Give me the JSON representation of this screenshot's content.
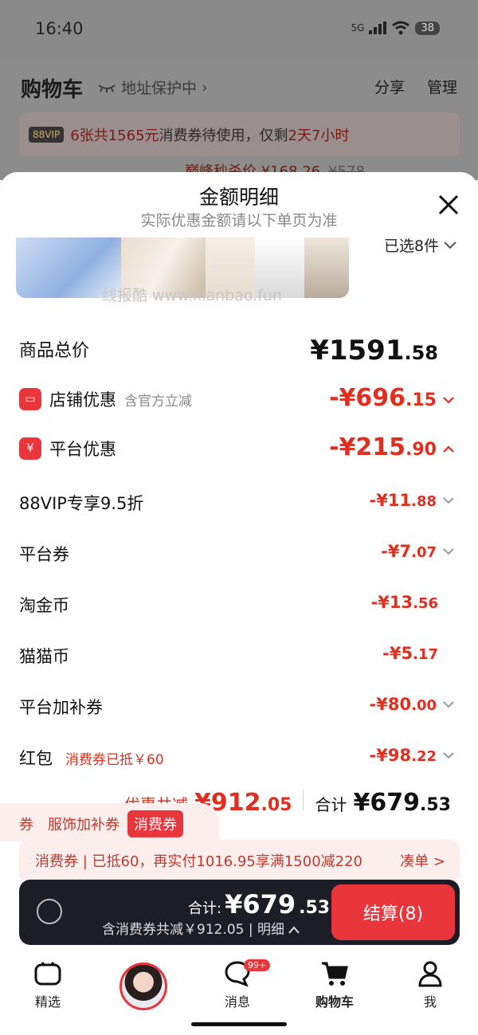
{
  "status": {
    "time": "16:40",
    "network": "5G",
    "battery": "38"
  },
  "header": {
    "title": "购物车",
    "address": "地址保护中",
    "share": "分享",
    "manage": "管理"
  },
  "vip_bar": {
    "tag": "88VIP",
    "text_prefix": "6张共1565元",
    "text_mid": "消费券待使用，仅剩",
    "text_red": "2天7小时"
  },
  "flash_sale": {
    "label": "巅峰秒杀价 ¥168.26",
    "original": "¥578"
  },
  "sheet": {
    "title": "金额明细",
    "subtitle": "实际优惠金额请以下单页为准",
    "selected": "已选8件",
    "watermark": "线报酷 www.xianbao.fun"
  },
  "rows": {
    "total": {
      "label": "商品总价",
      "int": "¥1591",
      "dec": ".58"
    },
    "store": {
      "label": "店铺优惠",
      "note": "含官方立减",
      "int": "-¥696",
      "dec": ".15"
    },
    "platform": {
      "label": "平台优惠",
      "int": "-¥215",
      "dec": ".90"
    },
    "vip": {
      "label": "88VIP专享9.5折",
      "int": "-¥11",
      "dec": ".88"
    },
    "coupon": {
      "label": "平台券",
      "int": "-¥7",
      "dec": ".07"
    },
    "taojin": {
      "label": "淘金币",
      "int": "-¥13",
      "dec": ".56"
    },
    "maomao": {
      "label": "猫猫币",
      "int": "-¥5",
      "dec": ".17"
    },
    "bonus": {
      "label": "平台加补券",
      "int": "-¥80",
      "dec": ".00"
    },
    "redpack": {
      "label": "红包",
      "note": "消费券已抵￥60",
      "int": "-¥98",
      "dec": ".22"
    }
  },
  "overlay": {
    "discount_label": "优惠共减",
    "discount_int": "¥912",
    "discount_dec": ".05",
    "total_label": "合计",
    "total_int": "¥679",
    "total_dec": ".53"
  },
  "tags": {
    "t1": "券",
    "t2": "服饰加补券",
    "t3": "消费券"
  },
  "promo": {
    "text": "消费券 | 已抵60，再实付1016.95享满1500减220",
    "action": "凑单 >"
  },
  "checkout": {
    "label": "合计:",
    "int": "¥679",
    "dec": ".53",
    "sub": "含消费券共减￥912.05 | 明细",
    "button": "结算(8)"
  },
  "nav": {
    "items": [
      "精选",
      "",
      "消息",
      "购物车",
      "我"
    ],
    "badge": "99+"
  },
  "colors": {
    "accent": "#e8363c",
    "price": "#e02f1e",
    "bar": "#1d1d27"
  }
}
